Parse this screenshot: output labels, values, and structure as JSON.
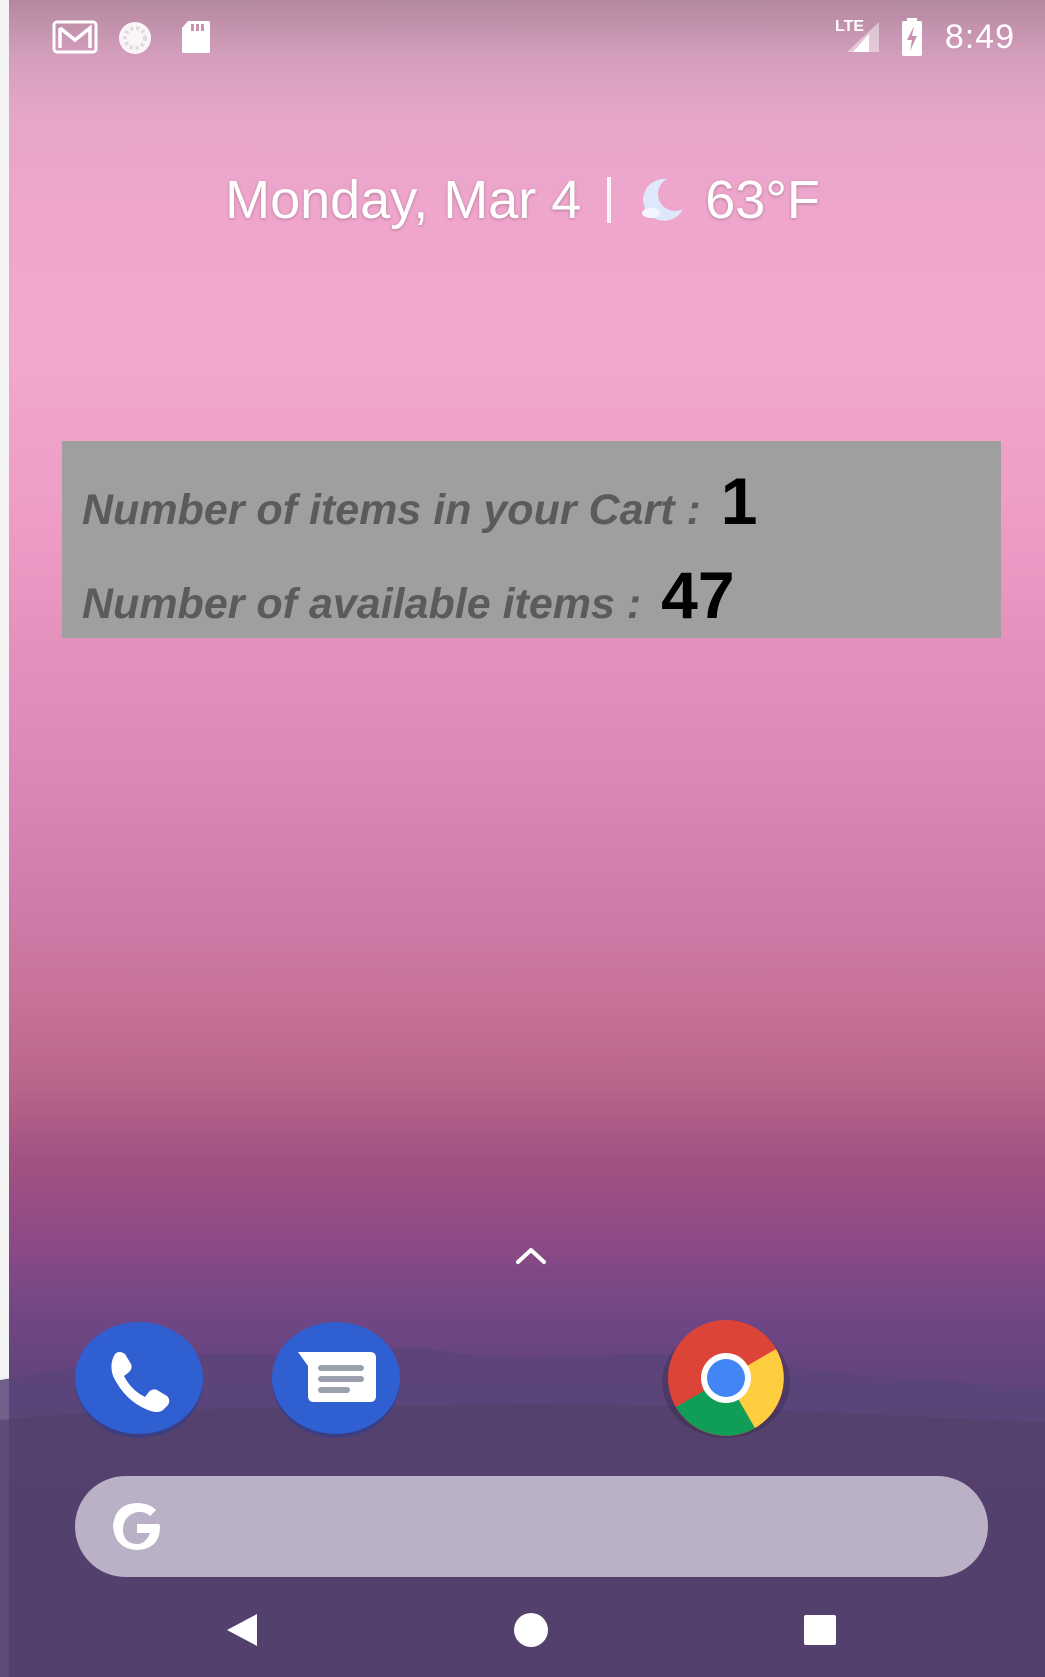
{
  "status_bar": {
    "time": "8:49",
    "network": "LTE",
    "icons": [
      "gmail-icon",
      "sync-icon",
      "sd-card-icon",
      "signal-icon",
      "battery-charging-icon"
    ]
  },
  "glance": {
    "date": "Monday, Mar 4",
    "temperature": "63°F",
    "weather_icon": "moon-icon"
  },
  "widget": {
    "cart_label": "Number of items in your Cart :",
    "cart_count": "1",
    "available_label": "Number of available items :",
    "available_count": "47"
  },
  "dock": {
    "apps": [
      "phone-icon",
      "messages-icon",
      "chrome-icon"
    ]
  },
  "search": {
    "logo": "google-g-icon"
  },
  "nav": {
    "buttons": [
      "back",
      "home",
      "recents"
    ]
  },
  "colors": {
    "widget_bg": "#a09fa0",
    "widget_label": "#5c5b5c",
    "phone_blue": "#2f5fd0",
    "messages_blue": "#2f5fd0"
  }
}
